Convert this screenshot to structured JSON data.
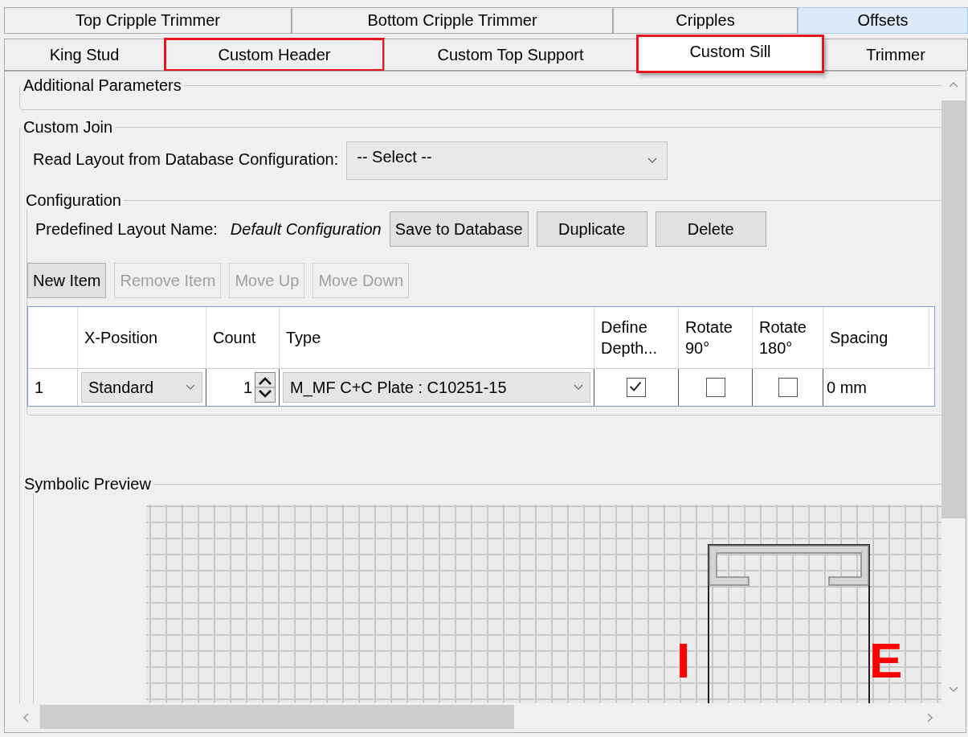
{
  "tabs_row_1": [
    {
      "label": "Top Cripple Trimmer",
      "selected": false,
      "highlighted": false,
      "hovered": false
    },
    {
      "label": "Bottom Cripple Trimmer",
      "selected": false,
      "highlighted": false,
      "hovered": false
    },
    {
      "label": "Cripples",
      "selected": false,
      "highlighted": false,
      "hovered": false
    },
    {
      "label": "Offsets",
      "selected": false,
      "highlighted": false,
      "hovered": true
    }
  ],
  "tabs_row_2": [
    {
      "label": "King Stud",
      "selected": false,
      "highlighted": false,
      "hovered": false
    },
    {
      "label": "Custom Header",
      "selected": false,
      "highlighted": true,
      "hovered": false
    },
    {
      "label": "Custom Top Support",
      "selected": false,
      "highlighted": false,
      "hovered": false
    },
    {
      "label": "Custom Sill",
      "selected": true,
      "highlighted": true,
      "hovered": false
    },
    {
      "label": "Trimmer",
      "selected": false,
      "highlighted": false,
      "hovered": false
    }
  ],
  "additional_parameters": {
    "title": "Additional Parameters"
  },
  "custom_join": {
    "title": "Custom Join",
    "read_layout_label": "Read Layout from Database Configuration:",
    "read_layout_select": {
      "value": "-- Select --"
    },
    "configuration": {
      "title": "Configuration",
      "layout_name_label": "Predefined Layout Name:",
      "layout_name": "Default Configuration",
      "buttons": [
        {
          "label": "Save to Database",
          "disabled": false
        },
        {
          "label": "Duplicate",
          "disabled": false
        },
        {
          "label": "Delete",
          "disabled": false
        }
      ],
      "item_buttons": [
        {
          "label": "New Item",
          "disabled": false
        },
        {
          "label": "Remove Item",
          "disabled": true
        },
        {
          "label": "Move Up",
          "disabled": true
        },
        {
          "label": "Move Down",
          "disabled": true
        }
      ],
      "table": {
        "columns": [
          "X-Position",
          "Count",
          "Type",
          "Define Depth...",
          "Rotate 90°",
          "Rotate 180°",
          "Spacing"
        ],
        "rows": [
          {
            "number": "1",
            "x_position": "Standard",
            "count": "1",
            "type": "M_MF C+C Plate : C10251-15",
            "define_depth": true,
            "rotate_90": false,
            "rotate_180": false,
            "spacing": "0 mm"
          }
        ]
      }
    }
  },
  "symbolic_preview": {
    "title": "Symbolic Preview",
    "interior_label": "I",
    "exterior_label": "E"
  }
}
